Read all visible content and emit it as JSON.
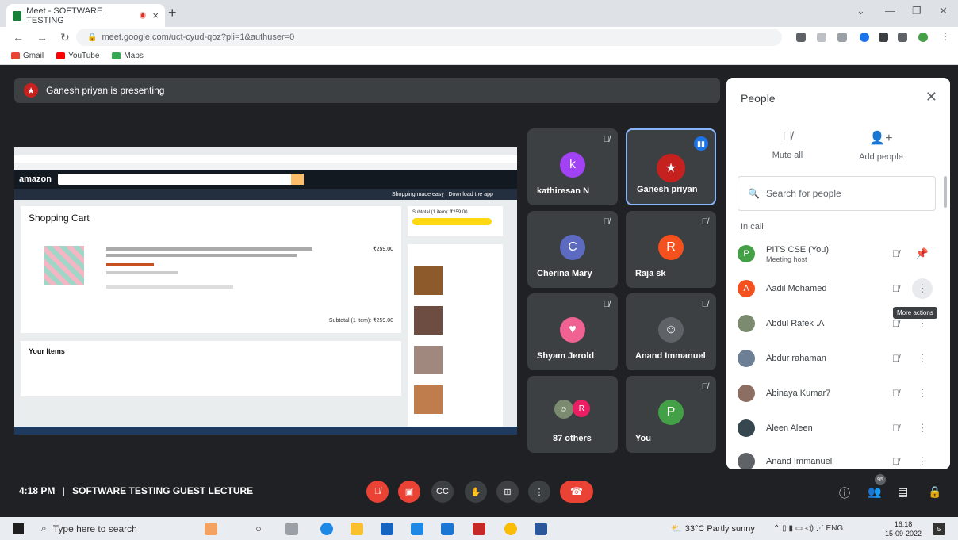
{
  "browser": {
    "tab_title": "Meet - SOFTWARE TESTING",
    "tab_close": "×",
    "new_tab": "+",
    "url": "meet.google.com/uct-cyud-qoz?pli=1&authuser=0",
    "bookmarks": [
      {
        "label": "Gmail",
        "color": "#ea4335"
      },
      {
        "label": "YouTube",
        "color": "#ff0000"
      },
      {
        "label": "Maps",
        "color": "#34a853"
      }
    ]
  },
  "meet": {
    "presenting_banner": "Ganesh priyan is presenting",
    "shared_screen": {
      "cart_title": "Shopping Cart",
      "subtotal_side": "Subtotal (1 item): ₹259.00",
      "subtotal_cart": "Subtotal (1 item): ₹259.00",
      "price": "₹259.00",
      "your_items": "Your Items",
      "amazon": "amazon",
      "promo": "Shopping made easy | Download the app"
    },
    "tiles": [
      {
        "name": "kathiresan N",
        "initial": "k",
        "color": "#a142f4"
      },
      {
        "name": "Ganesh priyan",
        "initial": "",
        "color": "#c5221f"
      },
      {
        "name": "Cherina Mary",
        "initial": "C",
        "color": "#5c6bc0"
      },
      {
        "name": "Raja sk",
        "initial": "R",
        "color": "#f4511e"
      },
      {
        "name": "Shyam Jerold",
        "initial": "",
        "color": "#f06292"
      },
      {
        "name": "Anand Immanuel",
        "initial": "",
        "color": "#5f6368"
      },
      {
        "name": "87 others",
        "initial": "R",
        "color": "#e91e63"
      },
      {
        "name": "You",
        "initial": "P",
        "color": "#43a047"
      }
    ]
  },
  "people_panel": {
    "title": "People",
    "mute_all": "Mute all",
    "add_people": "Add people",
    "search_placeholder": "Search for people",
    "in_call": "In call",
    "tooltip": "More actions",
    "participants": [
      {
        "name": "PITS CSE (You)",
        "sub": "Meeting host",
        "initial": "P",
        "color": "#43a047"
      },
      {
        "name": "Aadil Mohamed",
        "sub": "",
        "initial": "A",
        "color": "#f4511e"
      },
      {
        "name": "Abdul Rafek .A",
        "sub": "",
        "initial": "",
        "color": "#7a8b6f"
      },
      {
        "name": "Abdur rahaman",
        "sub": "",
        "initial": "",
        "color": "#6d7f95"
      },
      {
        "name": "Abinaya Kumar7",
        "sub": "",
        "initial": "",
        "color": "#8d6e63"
      },
      {
        "name": "Aleen Aleen",
        "sub": "",
        "initial": "",
        "color": "#37474f"
      },
      {
        "name": "Anand Immanuel",
        "sub": "",
        "initial": "",
        "color": "#5f6368"
      }
    ]
  },
  "bottom_bar": {
    "time": "4:18 PM",
    "separator": "|",
    "meeting_name": "SOFTWARE TESTING GUEST LECTURE",
    "people_count": "95"
  },
  "taskbar": {
    "search_placeholder": "Type here to search",
    "weather": "33°C  Partly sunny",
    "lang": "ENG",
    "clock_time": "16:18",
    "clock_date": "15-09-2022",
    "notifications": "5"
  }
}
